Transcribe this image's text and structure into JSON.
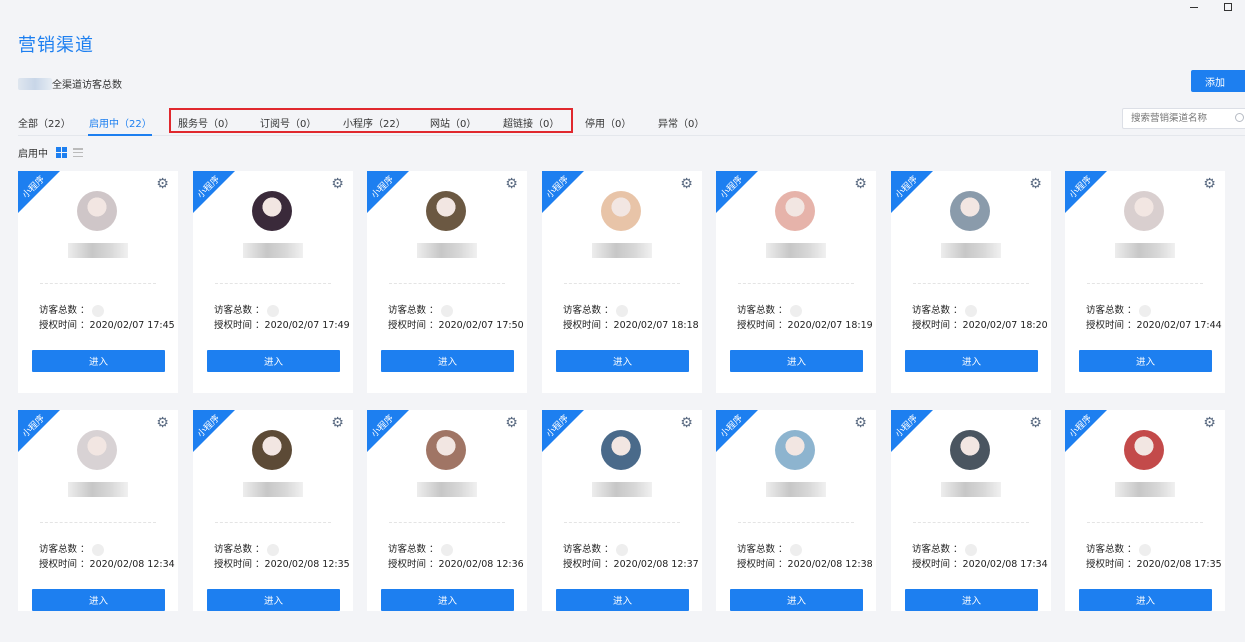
{
  "page": {
    "title": "营销渠道"
  },
  "summary": {
    "text": "全渠道访客总数"
  },
  "actions": {
    "add_label": "添加"
  },
  "tabs": [
    {
      "label": "全部（22）",
      "active": false
    },
    {
      "label": "启用中（22）",
      "active": true
    },
    {
      "label": "服务号（0）",
      "active": false
    },
    {
      "label": "订阅号（0）",
      "active": false
    },
    {
      "label": "小程序（22）",
      "active": false
    },
    {
      "label": "网站（0）",
      "active": false
    },
    {
      "label": "超链接（0）",
      "active": false
    },
    {
      "label": "停用（0）",
      "active": false
    },
    {
      "label": "异常（0）",
      "active": false
    }
  ],
  "search": {
    "placeholder": "搜索营销渠道名称"
  },
  "status": {
    "label": "启用中"
  },
  "card_labels": {
    "visitors": "访客总数 ：",
    "auth_time_prefix": "授权时间 ：",
    "enter": "进入",
    "ribbon": "小程序"
  },
  "cards": [
    {
      "auth_time": "2020/02/07 17:45",
      "avatar_color": "#cfc6c8"
    },
    {
      "auth_time": "2020/02/07 17:49",
      "avatar_color": "#3a2a3a"
    },
    {
      "auth_time": "2020/02/07 17:50",
      "avatar_color": "#6b5842"
    },
    {
      "auth_time": "2020/02/07 18:18",
      "avatar_color": "#e8c4a8"
    },
    {
      "auth_time": "2020/02/07 18:19",
      "avatar_color": "#e6b3aa"
    },
    {
      "auth_time": "2020/02/07 18:20",
      "avatar_color": "#8a9bab"
    },
    {
      "auth_time": "2020/02/07 17:44",
      "avatar_color": "#d9cfcf"
    },
    {
      "auth_time": "2020/02/08 12:34",
      "avatar_color": "#d8d2d4"
    },
    {
      "auth_time": "2020/02/08 12:35",
      "avatar_color": "#5c4a36"
    },
    {
      "auth_time": "2020/02/08 12:36",
      "avatar_color": "#a07565"
    },
    {
      "auth_time": "2020/02/08 12:37",
      "avatar_color": "#4a6a8a"
    },
    {
      "auth_time": "2020/02/08 12:38",
      "avatar_color": "#8db4cf"
    },
    {
      "auth_time": "2020/02/08 17:34",
      "avatar_color": "#4a5560"
    },
    {
      "auth_time": "2020/02/08 17:35",
      "avatar_color": "#c34a4a"
    }
  ],
  "colors": {
    "accent": "#1d7ff0",
    "highlight": "#e0282e"
  }
}
